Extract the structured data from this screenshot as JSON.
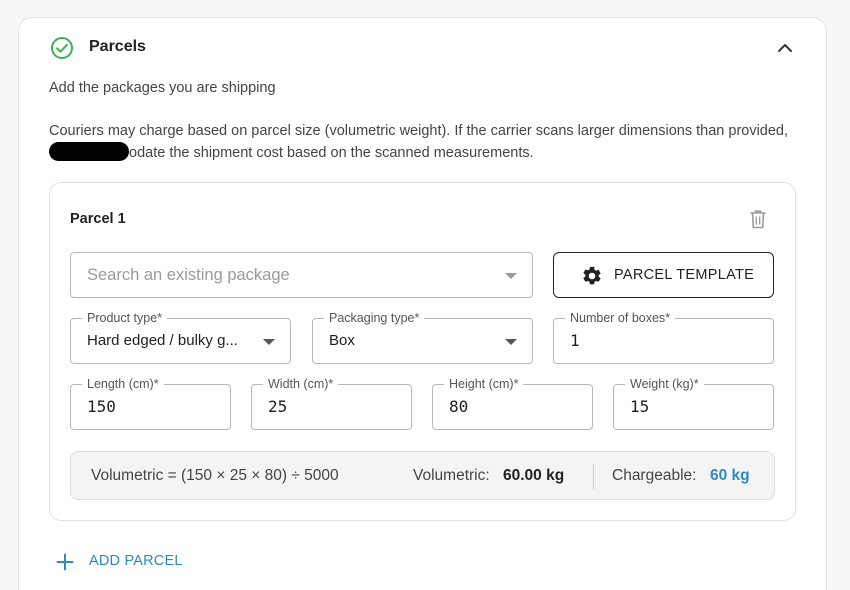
{
  "colors": {
    "success": "#3fae5a",
    "accent": "#2e8bc0",
    "text": "#1f1f1f"
  },
  "section": {
    "title": "Parcels",
    "subtitle": "Add the packages you are shipping",
    "notice_before": "Couriers may charge based on parcel size (volumetric weight). If the carrier scans larger dimensions than provided,",
    "notice_after": "odate the shipment cost based on the scanned measurements.",
    "icons": {
      "status": "check-circle-icon",
      "collapse": "chevron-up-icon"
    }
  },
  "parcel": {
    "title": "Parcel 1",
    "delete_icon": "trash-icon",
    "search": {
      "placeholder": "Search an existing package",
      "value": ""
    },
    "template_button": {
      "label": "PARCEL TEMPLATE",
      "icon": "gear-icon"
    },
    "product_type": {
      "label": "Product type",
      "value": "Hard edged / bulky g..."
    },
    "packaging_type": {
      "label": "Packaging type",
      "value": "Box"
    },
    "number_of_boxes": {
      "label": "Number of boxes",
      "value": "1"
    },
    "length": {
      "label": "Length (cm)",
      "value": "150"
    },
    "width": {
      "label": "Width (cm)",
      "value": "25"
    },
    "height": {
      "label": "Height (cm)",
      "value": "80"
    },
    "weight": {
      "label": "Weight (kg)",
      "value": "15"
    },
    "required_mark": "*",
    "calc": {
      "formula": "Volumetric = (150 × 25 × 80) ÷ 5000",
      "volumetric_label": "Volumetric:",
      "volumetric_value": "60.00 kg",
      "chargeable_label": "Chargeable:",
      "chargeable_value": "60 kg"
    }
  },
  "add_parcel": {
    "label": "ADD PARCEL",
    "icon": "plus-icon"
  }
}
